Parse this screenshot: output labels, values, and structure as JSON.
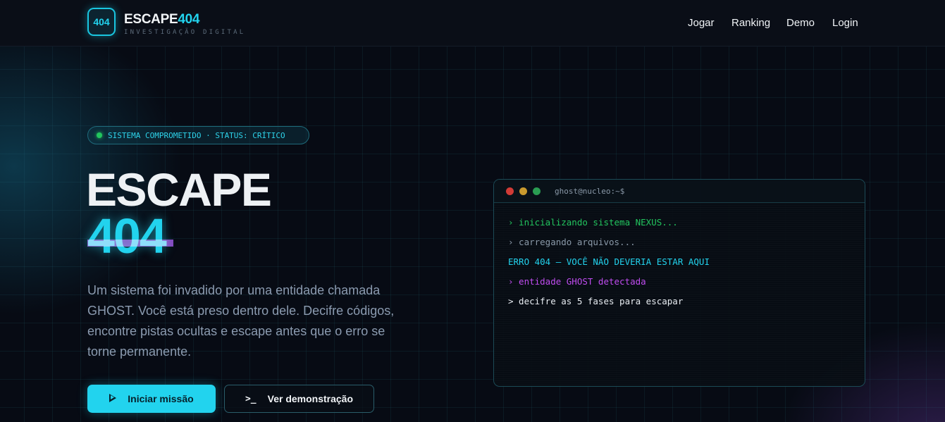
{
  "header": {
    "logo_text": "404",
    "brand_main": "ESCAPE",
    "brand_accent": "404",
    "subtitle": "INVESTIGAÇÃO DIGITAL",
    "nav": [
      "Jogar",
      "Ranking",
      "Demo",
      "Login"
    ]
  },
  "hero": {
    "badge": "SISTEMA COMPROMETIDO · STATUS: CRÍTICO",
    "title_line1": "ESCAPE",
    "title_line2": "404",
    "description": "Um sistema foi invadido por uma entidade chamada GHOST. Você está preso dentro dele. Decifre códigos, encontre pistas ocultas e escape antes que o erro se torne permanente.",
    "primary_button": "Iniciar missão",
    "secondary_button": "Ver demonstração",
    "secondary_icon_text": ">_"
  },
  "terminal": {
    "title": "ghost@nucleo:~$",
    "lines": [
      {
        "text": "› inicializando sistema NEXUS...",
        "color": "#22c55e"
      },
      {
        "text": "› carregando arquivos...",
        "color": "#8a99a8"
      },
      {
        "text": "ERRO 404 — VOCÊ NÃO DEVERIA ESTAR AQUI",
        "color": "#22d3ee"
      },
      {
        "text": "› entidade GHOST detectada",
        "color": "#c04cf0"
      },
      {
        "text": "> decifre as 5 fases para escapar",
        "color": "#e8edf2"
      }
    ]
  },
  "colors": {
    "accent": "#22d3ee",
    "background": "#070b14",
    "status_dot": "#22c55e",
    "window_red": "#d13b36",
    "window_yellow": "#c99a2e",
    "window_green": "#2a9d52"
  }
}
